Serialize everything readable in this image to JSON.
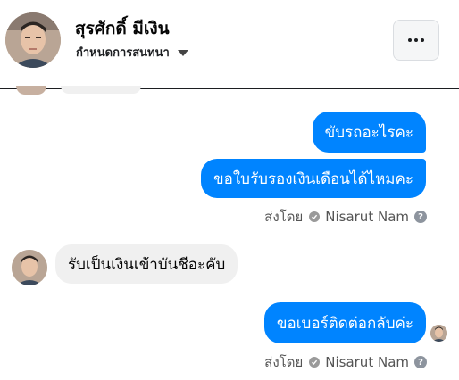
{
  "header": {
    "title": "สุรศักดิ์ มีเงิน",
    "subtitle": "กำหนดการสนทนา",
    "caret_icon": "caret-down-icon",
    "more_icon": "more-horizontal-icon"
  },
  "messages": [
    {
      "direction": "outgoing",
      "text": "ขับรถอะไรคะ"
    },
    {
      "direction": "outgoing",
      "text": "ขอใบรับรองเงินเดือนได้ไหมคะ"
    },
    {
      "direction": "incoming",
      "text": "รับเป็นเงินเข้าบันชีอะคับ"
    },
    {
      "direction": "outgoing",
      "text": "ขอเบอร์ติดต่อกลับค่ะ"
    }
  ],
  "sent_by": {
    "prefix": "ส่งโดย",
    "name": "Nisarut Nam",
    "help_glyph": "?"
  },
  "colors": {
    "outgoing_bubble": "#0084ff",
    "incoming_bubble": "#f0f0f0"
  }
}
